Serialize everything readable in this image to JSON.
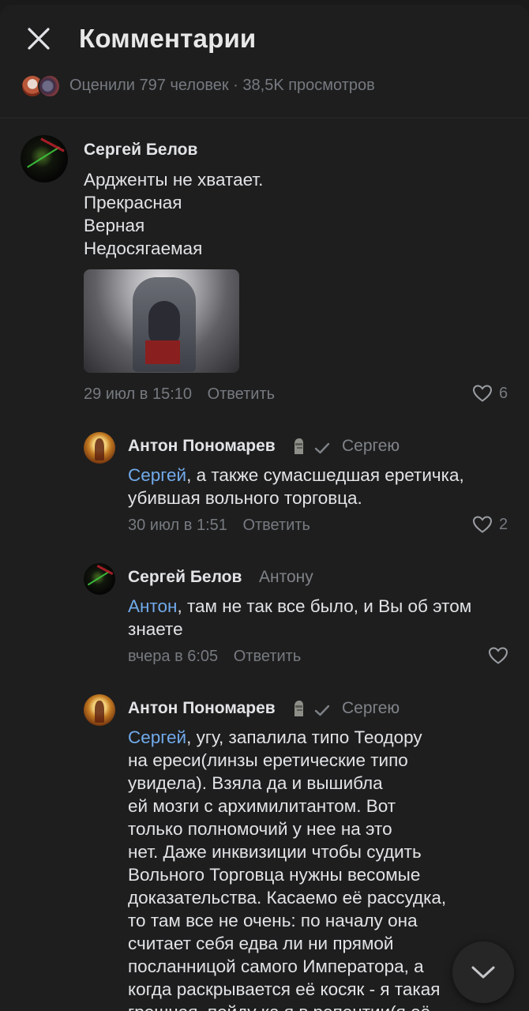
{
  "header": {
    "title": "Комментарии",
    "stats": "Оценили 797 человек · 38,5K просмотров"
  },
  "comments": [
    {
      "author": "Сергей Белов",
      "lines": [
        "Ардженты не хватает.",
        "Прекрасная",
        "Верная",
        "Недосягаемая"
      ],
      "date": "29 июл в 15:10",
      "reply_label": "Ответить",
      "likes": "6"
    },
    {
      "author": "Антон Пономарев",
      "reply_to": "Сергею",
      "mention": "Сергей",
      "text": ", а также сумасшедшая еретичка,",
      "text2": "убившая вольного торговца.",
      "date": "30 июл в 1:51",
      "reply_label": "Ответить",
      "likes": "2"
    },
    {
      "author": "Сергей Белов",
      "reply_to": "Антону",
      "mention": "Антон",
      "text": ", там не так все было, и Вы об этом",
      "text2": "знаете",
      "date": "вчера в 6:05",
      "reply_label": "Ответить",
      "likes": ""
    },
    {
      "author": "Антон Пономарев",
      "reply_to": "Сергею",
      "mention": "Сергей",
      "lines": [
        ", угу, запалила типо Теодору",
        "на ереси(линзы еретические типо",
        "увидела). Взяла да и вышибла",
        "ей мозги с архимилитантом. Вот",
        "только полномочий у нее на это",
        "нет. Даже инквизиции чтобы судить",
        "Вольного Торговца нужны весомые",
        "доказательства. Касаемо её рассудка,",
        "то там все не очень: по началу она",
        "считает себя едва ли ни прямой",
        "посланницой самого Императора, а",
        "когда раскрывается её косяк - я такая",
        "грешная, пойду ка я в репентии(я её"
      ]
    }
  ]
}
